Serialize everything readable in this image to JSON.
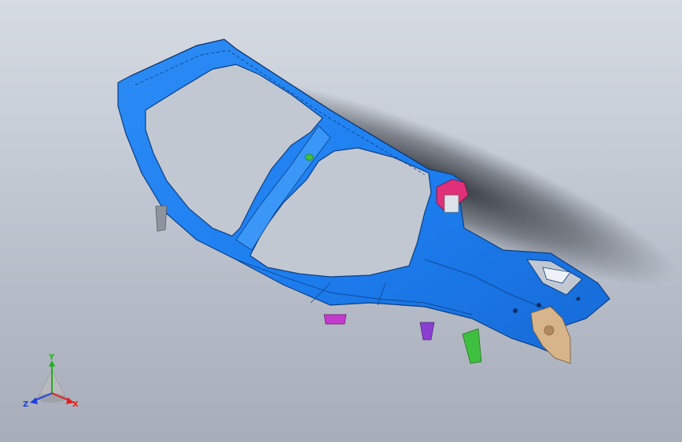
{
  "viewport": {
    "background_top": "#d6dbe3",
    "background_bottom": "#a7adb9"
  },
  "model": {
    "part_color": "#1e7ff0",
    "accent_colors": [
      "#e0307a",
      "#8a3fd1",
      "#3fbf3f",
      "#d8b48a"
    ]
  },
  "triad": {
    "x_label": "X",
    "y_label": "Y",
    "z_label": "Z",
    "x_color": "#e02020",
    "y_color": "#20b020",
    "z_color": "#2040e0"
  }
}
